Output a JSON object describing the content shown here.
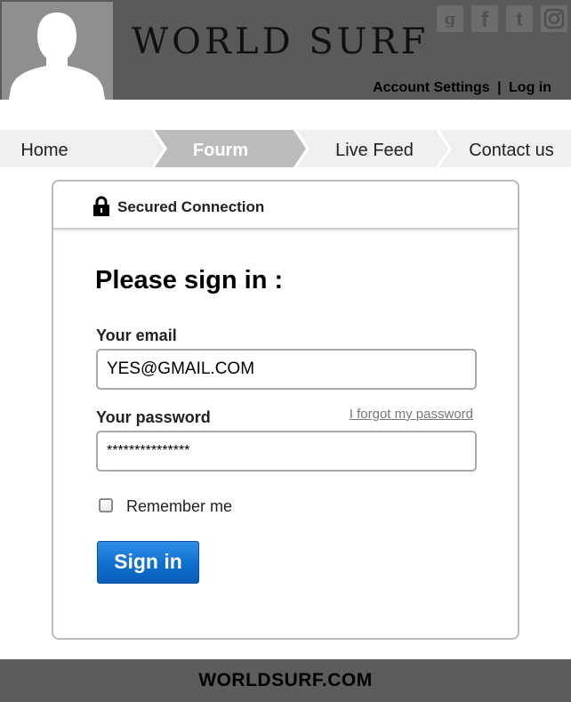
{
  "header": {
    "brand": "WORLD SURF",
    "social_icons": [
      "google-plus-icon",
      "facebook-icon",
      "twitter-icon",
      "instagram-icon"
    ],
    "account_settings": "Account Settings",
    "separator": "|",
    "login": "Log in"
  },
  "nav": {
    "items": [
      {
        "label": "Home",
        "active": false
      },
      {
        "label": "Fourm",
        "active": true
      },
      {
        "label": "Live Feed",
        "active": false
      },
      {
        "label": "Contact us",
        "active": false
      }
    ]
  },
  "card": {
    "secured_label": "Secured Connection",
    "title": "Please sign in :",
    "email_label": "Your email",
    "email_value": "YES@GMAIL.COM",
    "password_label": "Your password",
    "forgot_link": "I forgot my password",
    "password_value": "***************",
    "remember_label": "Remember me",
    "remember_checked": false,
    "signin_button": "Sign in"
  },
  "footer": {
    "text": "WORLDSURF.COM"
  },
  "colors": {
    "header_bg": "#5a5a5a",
    "nav_bg": "#efefef",
    "nav_active_bg": "#bcbcbc",
    "button_blue": "#0f6fcf",
    "footer_bg": "#5c5c5c"
  }
}
